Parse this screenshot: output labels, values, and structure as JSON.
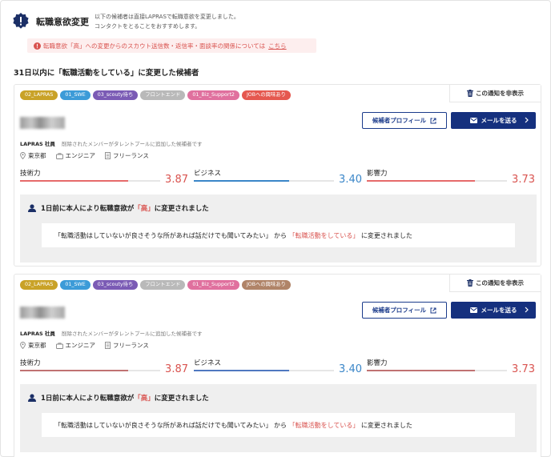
{
  "header": {
    "title": "転職意欲変更",
    "desc_line1": "以下の候補者は直接LAPRASで転職意欲を変更しました。",
    "desc_line2": "コンタクトをとることをおすすめします。",
    "alert_text": "転職意欲「高」への変更からのスカウト送信数・返信率・面談率の関係については",
    "alert_link": "こちら"
  },
  "section_title": "31日以内に「転職活動をしている」に変更した候補者",
  "colors": {
    "accent_red": "#d9534f",
    "navy": "#15307e",
    "blue_bar": "#3a86c8",
    "red_bar": "#e66a6a",
    "dark_red_bar": "#c07272",
    "notice_bg": "#efefef"
  },
  "cards": [
    {
      "tags": [
        {
          "label": "02_LAPRAS",
          "color": "#c9a227"
        },
        {
          "label": "01_SWE",
          "color": "#3c9bd8"
        },
        {
          "label": "03_scouty待ち",
          "color": "#7b5bb5"
        },
        {
          "label": "フロントエンド",
          "color": "#b9b9b9"
        },
        {
          "label": "01_Biz_Support2",
          "color": "#e0709e"
        },
        {
          "label": "JOBへの興味あり",
          "color": "#e5584f"
        }
      ],
      "hide_label": "この通知を非表示",
      "profile_label": "候補者プロフィール",
      "mail_label": "メールを送る",
      "org": "LAPRAS 社員",
      "org_note": "削除されたメンバーがタレントプールに追加した候補者です",
      "location": "東京都",
      "job": "エンジニア",
      "employment": "フリーランス",
      "scores": [
        {
          "label": "技術力",
          "value": "3.87",
          "fraction": 0.77,
          "color": "#e66a6a",
          "text_color": "#d9534f"
        },
        {
          "label": "ビジネス",
          "value": "3.40",
          "fraction": 0.68,
          "color": "#3a86c8",
          "text_color": "#3a86c8"
        },
        {
          "label": "影響力",
          "value": "3.73",
          "fraction": 0.77,
          "color": "#e66a6a",
          "text_color": "#d9534f"
        }
      ],
      "notice_pre": "1日前に本人により転職意欲が",
      "notice_hl": "「高」",
      "notice_post": "に変更されました",
      "change_from": "「転職活動はしていないが良さそうな所があれば話だけでも聞いてみたい」 から",
      "change_to": "「転職活動をしている」",
      "change_post": "に変更されました"
    },
    {
      "tags": [
        {
          "label": "02_LAPRAS",
          "color": "#c9a227"
        },
        {
          "label": "01_SWE",
          "color": "#3c9bd8"
        },
        {
          "label": "03_scouty待ち",
          "color": "#7b5bb5"
        },
        {
          "label": "フロントエンド",
          "color": "#b9b9b9"
        },
        {
          "label": "01_Biz_Support2",
          "color": "#e0709e"
        },
        {
          "label": "JOBへの興味あり",
          "color": "#b08468"
        }
      ],
      "hide_label": "この通知を非表示",
      "profile_label": "候補者プロフィール",
      "mail_label": "メールを送る",
      "org": "LAPRAS 社員",
      "org_note": "削除されたメンバーがタレントプールに追加した候補者です",
      "location": "東京都",
      "job": "エンジニア",
      "employment": "フリーランス",
      "scores": [
        {
          "label": "技術力",
          "value": "3.87",
          "fraction": 0.77,
          "color": "#c07272",
          "text_color": "#d9534f"
        },
        {
          "label": "ビジネス",
          "value": "3.40",
          "fraction": 0.68,
          "color": "#4f78c0",
          "text_color": "#3a86c8"
        },
        {
          "label": "影響力",
          "value": "3.73",
          "fraction": 0.77,
          "color": "#c07272",
          "text_color": "#d9534f"
        }
      ],
      "notice_pre": "1日前に本人により転職意欲が",
      "notice_hl": "「高」",
      "notice_post": "に変更されました",
      "change_from": "「転職活動はしていないが良さそうな所があれば話だけでも聞いてみたい」 から",
      "change_to": "「転職活動をしている」",
      "change_post": "に変更されました"
    }
  ]
}
